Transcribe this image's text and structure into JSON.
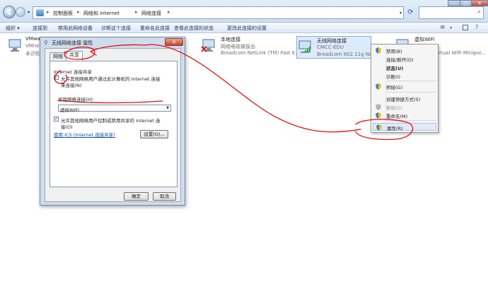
{
  "explorer": {
    "address": {
      "crumbs": [
        "控制面板",
        "网络和 Internet",
        "网络连接"
      ],
      "separator": "▸"
    },
    "search_icon": "search-icon",
    "toolbar": {
      "items": [
        "组织 ▾",
        "连接到",
        "禁用此网络设备",
        "诊断这个连接",
        "重命名此连接",
        "查看此连接的状态",
        "更改此连接的设置"
      ]
    }
  },
  "connections": [
    {
      "name": "VMwa",
      "line2": "VMne",
      "line3": "未识别"
    },
    {
      "name": "本地连接",
      "line2": "网络电缆被拔出",
      "line3": "Broadcom NetLink (TM) Fast E..."
    },
    {
      "name": "无线网络连接",
      "line2": "CMCC-EDU",
      "line3": "Broadcom 802.11g Netw"
    },
    {
      "name": "虚拟WiFi",
      "line2": "",
      "line3": "rtual WiFi Minipor..."
    }
  ],
  "dialog": {
    "title": "无线网络连接 属性",
    "tabs": [
      "网络",
      "共享"
    ],
    "group_label": "Internet 连接共享",
    "allow_sharing": {
      "line1": "允许其他网络用户通过此计算机的 Internet 连接",
      "line2": "来连接(N)",
      "checked": "✓"
    },
    "home_network_label": "家庭网络连接(H):",
    "home_network_value": "虚拟WIFI",
    "allow_control": {
      "line1": "允许其他网络用户控制或禁用共享的 Internet 连",
      "line2": "接(O)",
      "checked": "✓"
    },
    "ics_link": "使用 ICS (Internet 连接共享)",
    "settings_button": "设置(G)...",
    "ok_button": "确定",
    "cancel_button": "取消",
    "close_glyph": "✕"
  },
  "context_menu": {
    "items": [
      "禁用(B)",
      "连接/断开(O)",
      "状态(U)",
      "诊断(I)",
      "桥接(G)",
      "创建快捷方式(S)",
      "删除(D)",
      "重命名(M)",
      "属性(R)"
    ]
  },
  "colors": {
    "annotation": "#e01010",
    "accent": "#3a64a0"
  }
}
